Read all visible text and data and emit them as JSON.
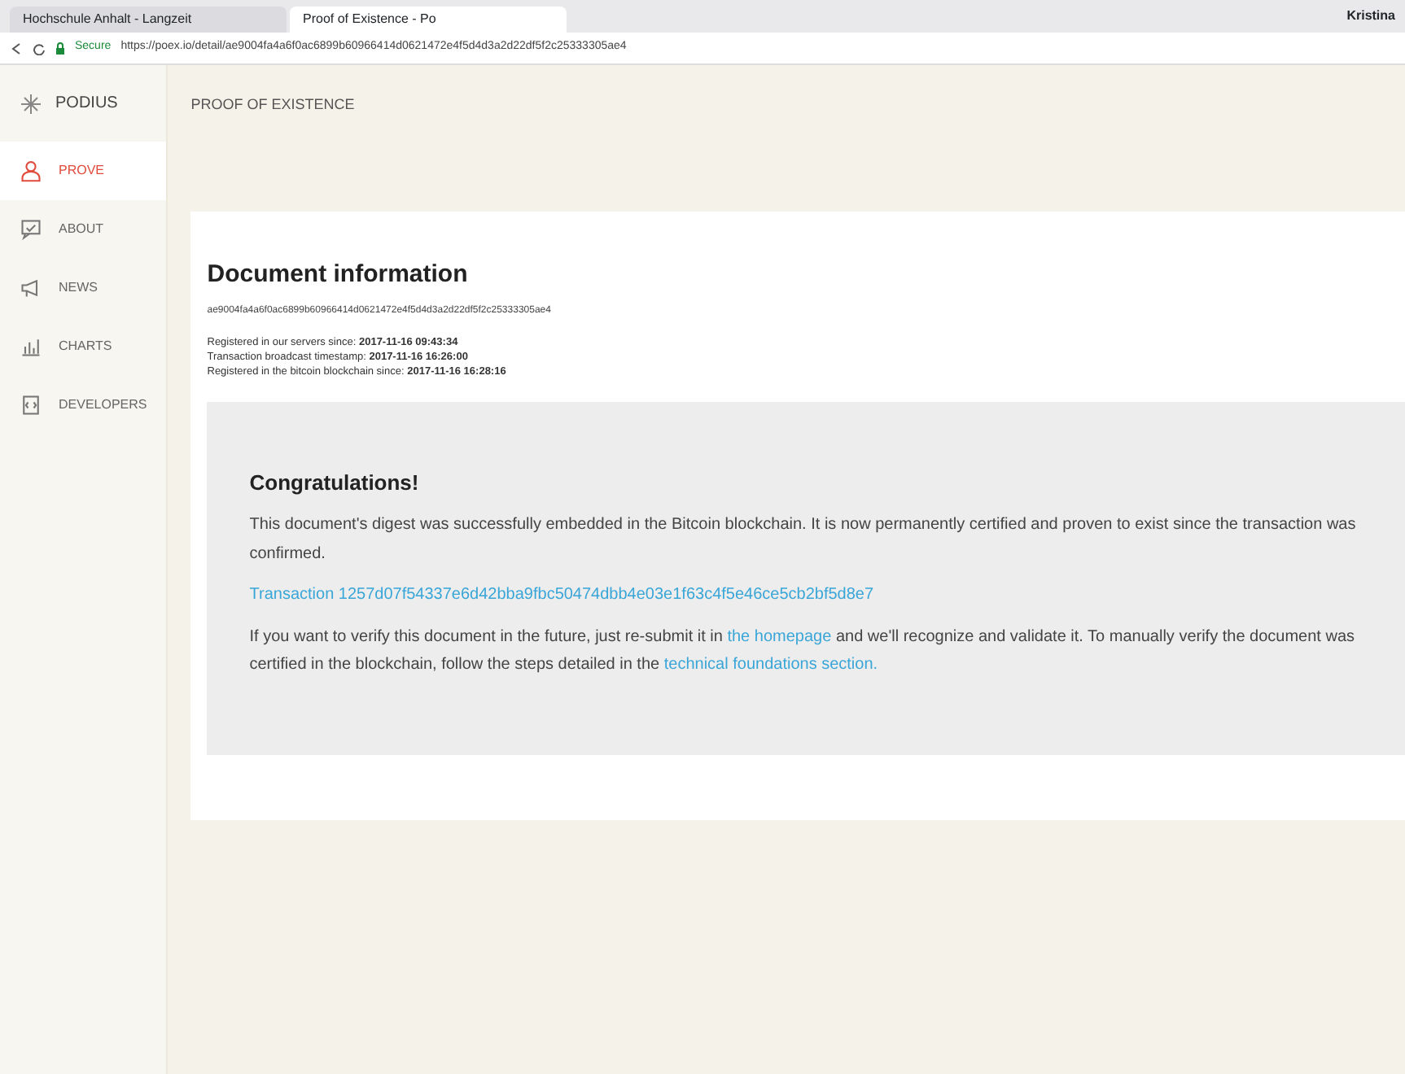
{
  "browser": {
    "tabs": [
      {
        "title": "Hochschule Anhalt - Langzeit",
        "selected": false
      },
      {
        "title": "Proof of Existence - Po",
        "selected": true
      }
    ],
    "secure_label": "Secure",
    "url": "https://poex.io/detail/ae9004fa4a6f0ac6899b60966414d0621472e4f5d4d3a2d22df5f2c25333305ae4",
    "profile": "Kristina"
  },
  "sidebar": {
    "logo": "PODIUS",
    "items": [
      {
        "label": "PROVE",
        "selected": true
      },
      {
        "label": "ABOUT",
        "selected": false
      },
      {
        "label": "NEWS",
        "selected": false
      },
      {
        "label": "CHARTS",
        "selected": false
      },
      {
        "label": "DEVELOPERS",
        "selected": false
      }
    ]
  },
  "header": {
    "title": "PROOF OF EXISTENCE"
  },
  "document": {
    "title": "Document information",
    "digest": "ae9004fa4a6f0ac6899b60966414d0621472e4f5d4d3a2d22df5f2c25333305ae4",
    "facts": [
      {
        "label": "Registered in our servers since:",
        "value": "2017-11-16 09:43:34"
      },
      {
        "label": "Transaction broadcast timestamp:",
        "value": "2017-11-16 16:26:00"
      },
      {
        "label": "Registered in the bitcoin blockchain since:",
        "value": "2017-11-16 16:28:16"
      }
    ]
  },
  "result": {
    "title": "Congratulations!",
    "message": "This document's digest was successfully embedded in the Bitcoin blockchain. It is now permanently certified and proven to exist since the transaction was confirmed.",
    "transaction_link": "Transaction 1257d07f54337e6d42bba9fbc50474dbb4e03e1f63c4f5e46ce5cb2bf5d8e7",
    "verify_parts": [
      {
        "kind": "text",
        "text": "If you want to verify this document in the future, just re-submit it in "
      },
      {
        "kind": "link",
        "text": "the homepage"
      },
      {
        "kind": "text",
        "text": " and we'll recognize and validate it. To manually verify the document was certified in the blockchain, follow the steps detailed in the "
      },
      {
        "kind": "link",
        "text": "technical foundations section."
      }
    ]
  }
}
